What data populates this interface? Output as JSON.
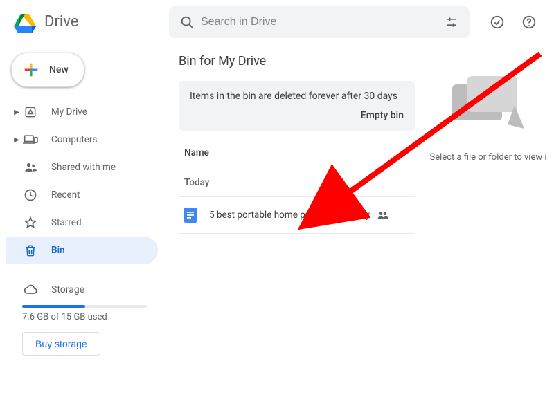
{
  "brand": {
    "name": "Drive"
  },
  "search": {
    "placeholder": "Search in Drive"
  },
  "new_btn": {
    "label": "New"
  },
  "sidebar": {
    "items": [
      {
        "label": "My Drive"
      },
      {
        "label": "Computers"
      },
      {
        "label": "Shared with me"
      },
      {
        "label": "Recent"
      },
      {
        "label": "Starred"
      },
      {
        "label": "Bin"
      }
    ],
    "storage_label": "Storage",
    "storage_text": "7.6 GB of 15 GB used",
    "buy_label": "Buy storage"
  },
  "main": {
    "title": "Bin for My Drive",
    "banner_text": "Items in the bin are deleted forever after 30 days",
    "empty_bin": "Empty bin",
    "col_name": "Name",
    "group_today": "Today",
    "files": [
      {
        "name": "5 best portable home projectors to buy"
      }
    ]
  },
  "details": {
    "hint": "Select a file or folder to view i"
  }
}
